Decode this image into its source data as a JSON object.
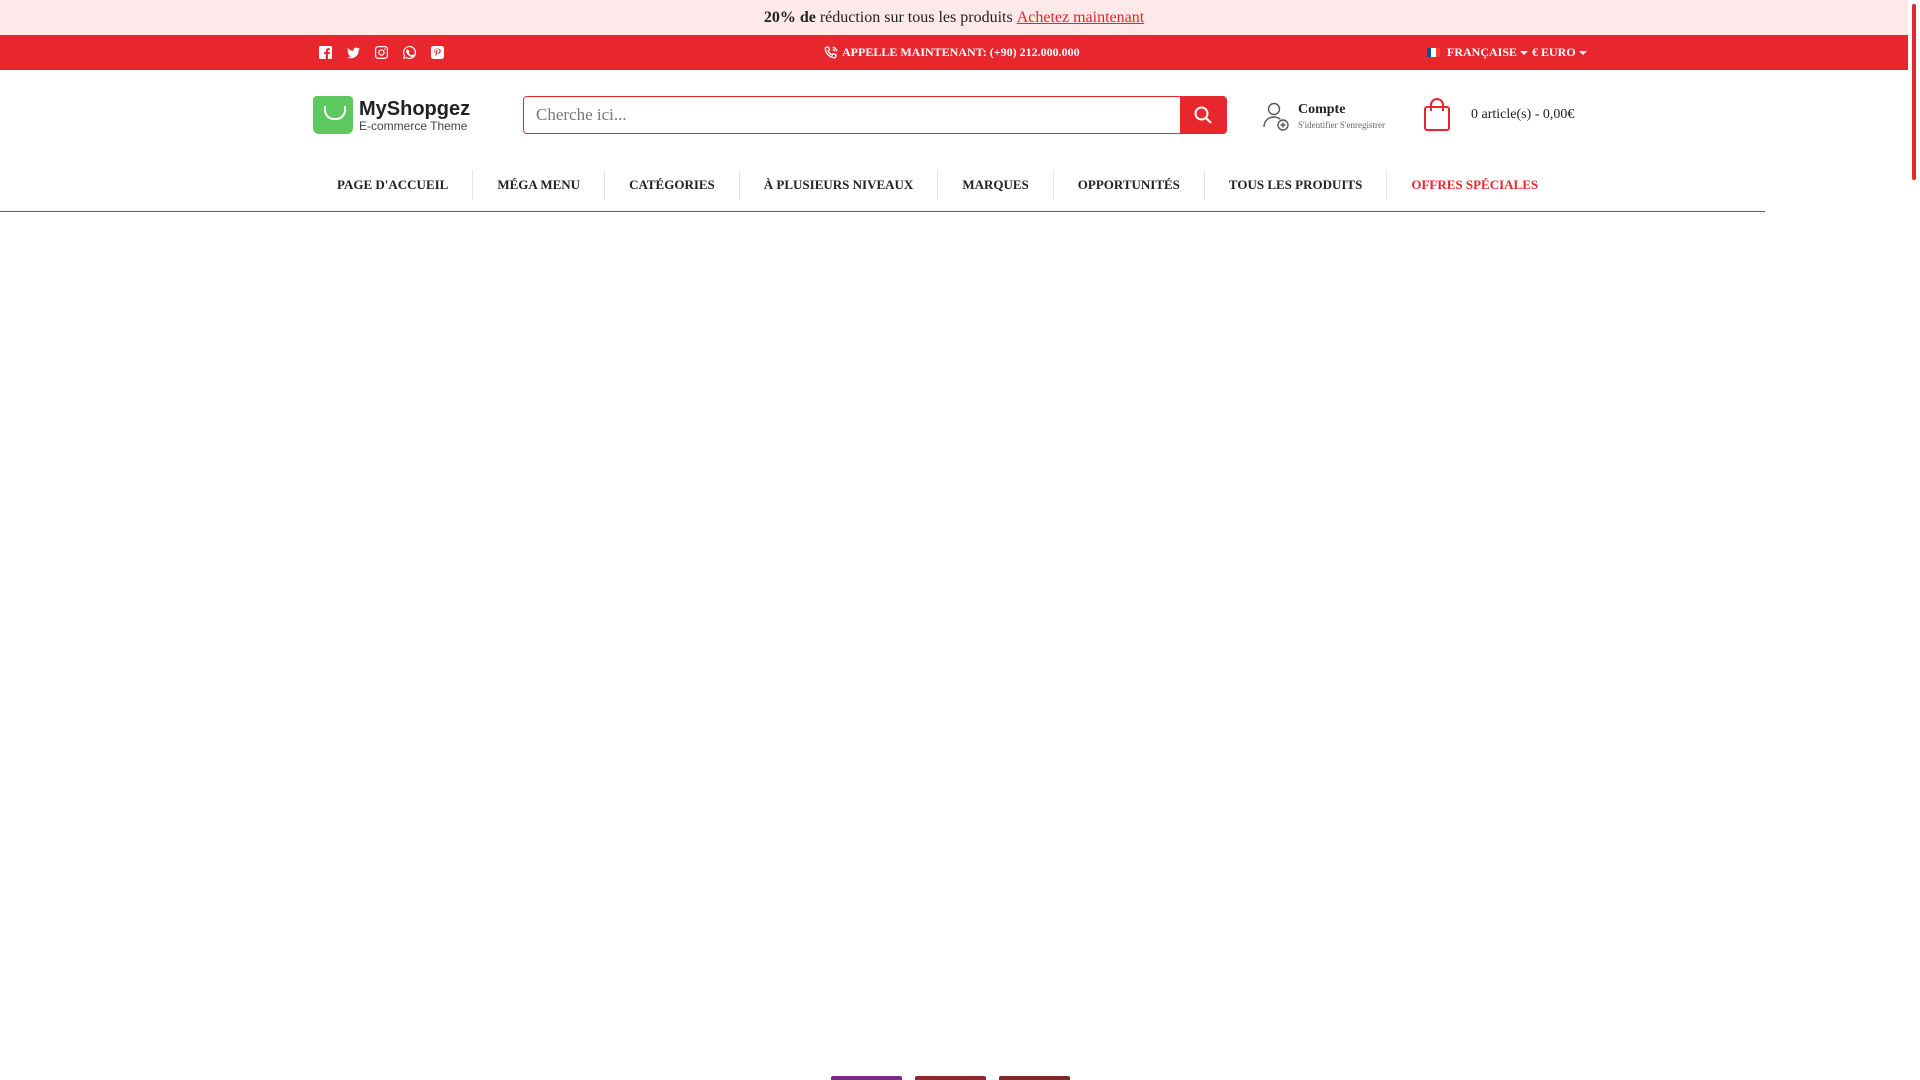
{
  "promo": {
    "bold": "20% de",
    "text": "réduction sur tous les produits",
    "link": "Achetez maintenant"
  },
  "topbar": {
    "social": [
      "facebook-icon",
      "twitter-icon",
      "instagram-icon",
      "whatsapp-icon",
      "pinterest-icon"
    ],
    "phone": "APPELLE MAINTENANT: (+90) 212.000.000",
    "language": "FRANÇAISE",
    "currency": "€ EURO"
  },
  "logo": {
    "name": "MyShopgez",
    "tagline": "E-commerce Theme"
  },
  "search": {
    "placeholder": "Cherche ici..."
  },
  "account": {
    "title": "Compte",
    "login": "S'identifier",
    "register": "S'enregistrer"
  },
  "cart": {
    "summary": "0 article(s) - 0,00€"
  },
  "nav": {
    "items": [
      "PAGE D'ACCUEIL",
      "MÉGA MENU",
      "CATÉGORIES",
      "À PLUSIEURS NIVEAUX",
      "MARQUES",
      "OPPORTUNITÉS",
      "TOUS LES PRODUITS",
      "OFFRES SPÉCIALES"
    ]
  },
  "colors": {
    "accent": "#e8262e",
    "promo_bg": "#fde8ea",
    "brand_green": "#5cc85f"
  }
}
